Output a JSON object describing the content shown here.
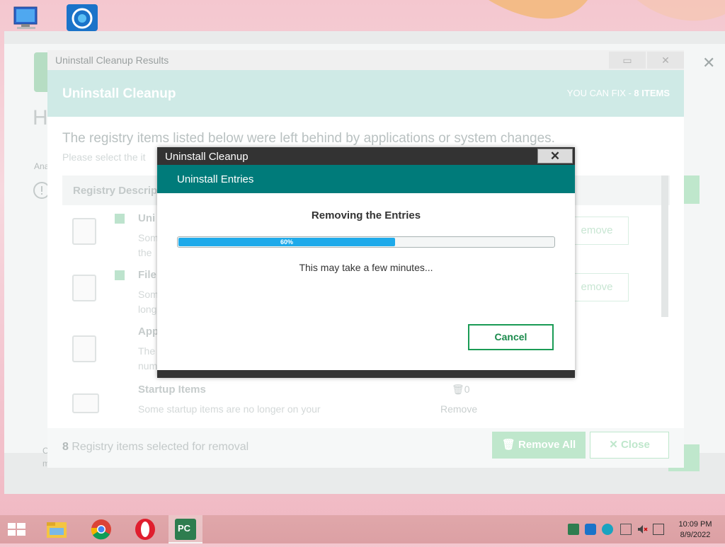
{
  "desktop": {
    "icons": [
      "computer-icon",
      "browser-icon"
    ]
  },
  "back_window": {
    "heading_initial": "H",
    "small_text_1": "Ana",
    "small_text_2": "C",
    "small_text_3": "m"
  },
  "results_window": {
    "title": "Uninstall Cleanup Results",
    "header_title": "Uninstall Cleanup",
    "can_fix_prefix": "YOU CAN FIX - ",
    "can_fix_count": "8 ITEMS",
    "lead": "The registry items listed below were left behind by applications or system changes.",
    "sub": "Please select the it",
    "column_header": "Registry Descrip",
    "rows": [
      {
        "name": "Uni",
        "desc1": "Some",
        "desc2": "the",
        "button": "emove",
        "checked": true
      },
      {
        "name": "File",
        "desc1": "Som",
        "desc2": "long",
        "button": "emove",
        "checked": true
      },
      {
        "name": "App",
        "desc1": "The",
        "desc2": "num"
      },
      {
        "name": "Startup Items",
        "desc1": "Some startup items are no longer on your",
        "count": "0",
        "count_label": "Remove"
      }
    ],
    "footer_count": "8",
    "footer_text": " Registry items selected for removal",
    "remove_all_label": "Remove All",
    "close_label": "Close"
  },
  "modal": {
    "title": "Uninstall Cleanup",
    "close_glyph": "✕",
    "section": "Uninstall Entries",
    "status": "Removing the Entries",
    "progress_percent": 60,
    "progress_label": "60%",
    "note": "This may take a few minutes...",
    "cancel_label": "Cancel"
  },
  "taskbar": {
    "apps": [
      "file-explorer-icon",
      "chrome-icon",
      "opera-icon",
      "pc-cleaner-icon"
    ],
    "tray": [
      "pc-cleaner-tray-icon",
      "security-shield-icon",
      "network-star-icon",
      "network-icon",
      "volume-muted-icon",
      "display-icon"
    ],
    "time": "10:09 PM",
    "date": "8/9/2022"
  },
  "colors": {
    "teal": "#007b7a",
    "progress": "#1eaaea",
    "cancel_green": "#1a9b55",
    "dark_bar": "#333333"
  }
}
